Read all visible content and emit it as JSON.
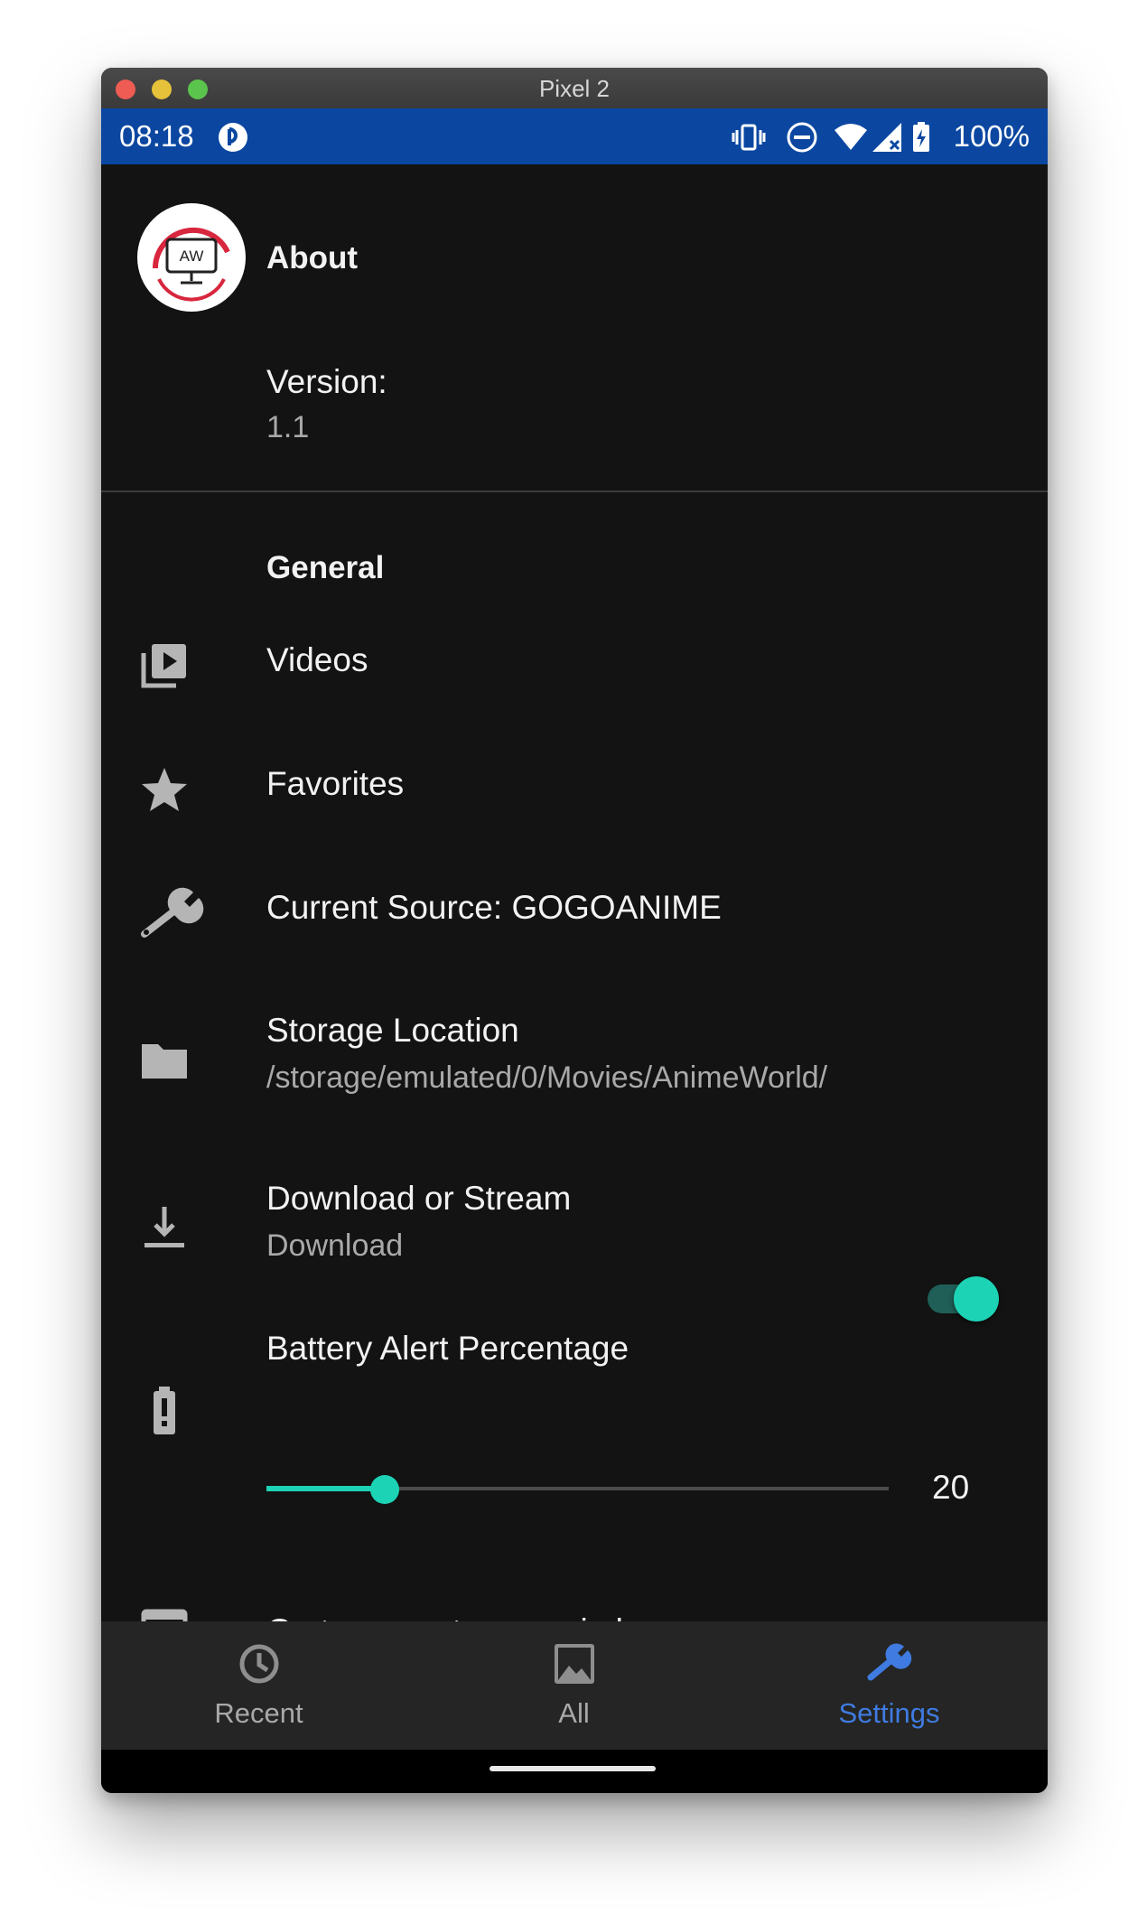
{
  "window": {
    "title": "Pixel 2"
  },
  "status_bar": {
    "time": "08:18",
    "battery": "100%"
  },
  "about": {
    "heading": "About",
    "version_label": "Version:",
    "version_value": "1.1",
    "logo_text": "AW"
  },
  "general": {
    "heading": "General",
    "videos": "Videos",
    "favorites": "Favorites",
    "current_source": "Current Source: GOGOANIME",
    "storage_title": "Storage Location",
    "storage_path": "/storage/emulated/0/Movies/AnimeWorld/",
    "download_title": "Download or Stream",
    "download_value": "Download",
    "download_toggle_on": true,
    "battery_title": "Battery Alert Percentage",
    "battery_value": "20",
    "battery_slider_fraction": 0.19,
    "browser": "Go to current source in browser"
  },
  "bottom_nav": {
    "recent": "Recent",
    "all": "All",
    "settings": "Settings",
    "active": "settings"
  },
  "colors": {
    "accent": "#1dd3b6",
    "status_bar": "#0b47a1",
    "active_nav": "#3f7be0",
    "background": "#121312"
  },
  "icons": {
    "status": [
      "app-icon",
      "vibrate-icon",
      "do-not-disturb-icon",
      "wifi-icon",
      "signal-icon",
      "battery-charging-icon"
    ],
    "rows": [
      "video-library-icon",
      "star-icon",
      "wrench-icon",
      "folder-icon",
      "download-icon",
      "battery-alert-icon",
      "open-in-browser-icon"
    ],
    "nav": [
      "clock-icon",
      "image-icon",
      "wrench-icon"
    ]
  }
}
